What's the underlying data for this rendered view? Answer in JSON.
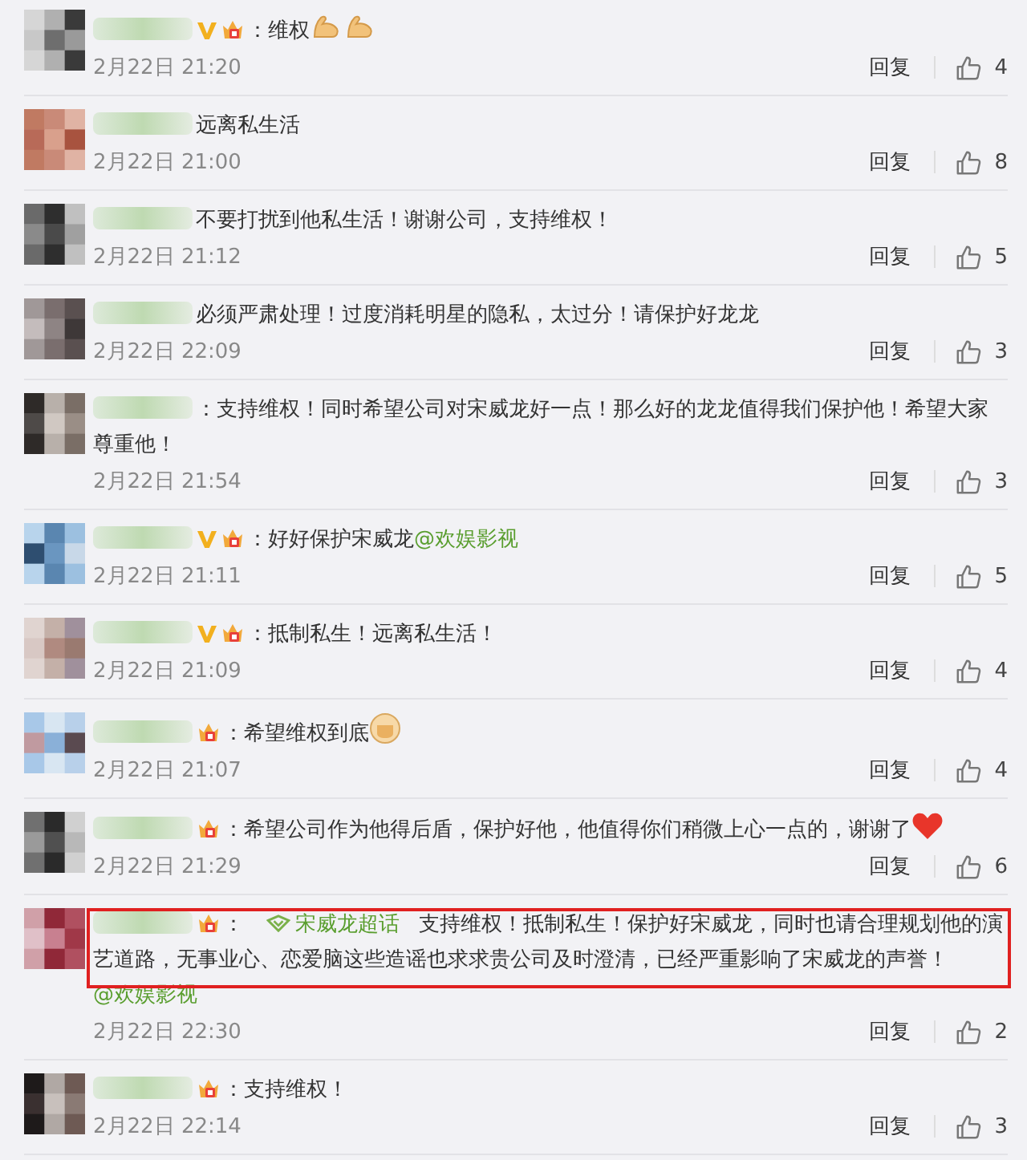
{
  "comments": [
    {
      "verified": true,
      "crown": true,
      "highlighted": false,
      "parts": [
        {
          "kind": "text",
          "text": "：维权"
        },
        {
          "kind": "flex"
        },
        {
          "kind": "flex"
        }
      ],
      "time": "2月22日 21:20",
      "reply": "回复",
      "likes": "4"
    },
    {
      "verified": false,
      "crown": false,
      "highlighted": false,
      "parts": [
        {
          "kind": "text",
          "text": "远离私生活"
        }
      ],
      "time": "2月22日 21:00",
      "reply": "回复",
      "likes": "8"
    },
    {
      "verified": false,
      "crown": false,
      "highlighted": false,
      "parts": [
        {
          "kind": "text",
          "text": "不要打扰到他私生活！谢谢公司，支持维权！"
        }
      ],
      "time": "2月22日 21:12",
      "reply": "回复",
      "likes": "5"
    },
    {
      "verified": false,
      "crown": false,
      "highlighted": false,
      "parts": [
        {
          "kind": "text",
          "text": "必须严肃处理！过度消耗明星的隐私，太过分！请保护好龙龙"
        }
      ],
      "time": "2月22日 22:09",
      "reply": "回复",
      "likes": "3"
    },
    {
      "verified": false,
      "crown": false,
      "highlighted": false,
      "parts": [
        {
          "kind": "text",
          "text": "：支持维权！同时希望公司对宋威龙好一点！那么好的龙龙值得我们保护他！希望大家尊重他！"
        }
      ],
      "time": "2月22日 21:54",
      "reply": "回复",
      "likes": "3"
    },
    {
      "verified": true,
      "crown": true,
      "highlighted": false,
      "parts": [
        {
          "kind": "text",
          "text": "：好好保护宋威龙"
        },
        {
          "kind": "mention",
          "text": "@欢娱影视"
        }
      ],
      "time": "2月22日 21:11",
      "reply": "回复",
      "likes": "5"
    },
    {
      "verified": true,
      "crown": true,
      "highlighted": false,
      "parts": [
        {
          "kind": "text",
          "text": "：抵制私生！远离私生活！"
        }
      ],
      "time": "2月22日 21:09",
      "reply": "回复",
      "likes": "4"
    },
    {
      "verified": false,
      "crown": true,
      "highlighted": false,
      "parts": [
        {
          "kind": "text",
          "text": "：希望维权到底"
        },
        {
          "kind": "fist"
        }
      ],
      "time": "2月22日 21:07",
      "reply": "回复",
      "likes": "4"
    },
    {
      "verified": false,
      "crown": true,
      "highlighted": false,
      "parts": [
        {
          "kind": "text",
          "text": "：希望公司作为他得后盾，保护好他，他值得你们稍微上心一点的，谢谢了"
        },
        {
          "kind": "heart"
        }
      ],
      "time": "2月22日 21:29",
      "reply": "回复",
      "likes": "6"
    },
    {
      "verified": false,
      "crown": true,
      "highlighted": true,
      "parts": [
        {
          "kind": "text",
          "text": "："
        },
        {
          "kind": "topic",
          "text": "宋威龙超话"
        },
        {
          "kind": "text",
          "text": "支持维权！抵制私生！保护好宋威龙，同时也请合理规划他的演艺道路，无事业心、恋爱脑这些造谣也求求贵公司及时澄清，已经严重影响了宋威龙的声誉！"
        },
        {
          "kind": "mention",
          "text": "@欢娱影视"
        }
      ],
      "time": "2月22日 22:30",
      "reply": "回复",
      "likes": "2"
    },
    {
      "verified": false,
      "crown": true,
      "highlighted": false,
      "parts": [
        {
          "kind": "text",
          "text": "：支持维权！"
        }
      ],
      "time": "2月22日 22:14",
      "reply": "回复",
      "likes": "3"
    }
  ]
}
